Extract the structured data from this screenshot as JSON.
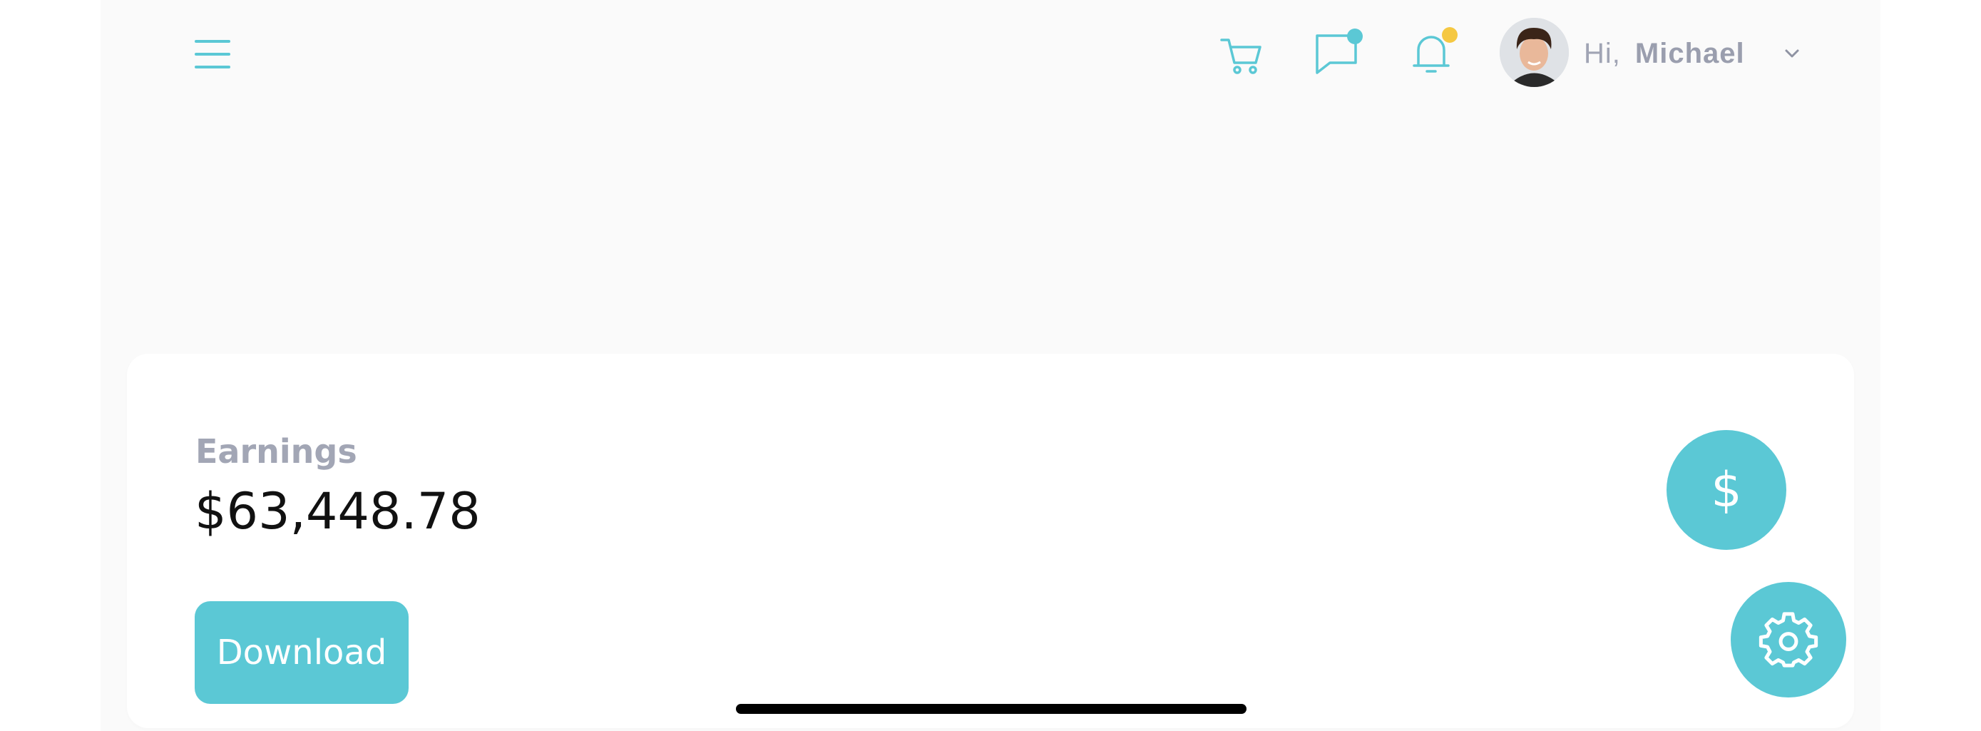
{
  "header": {
    "greeting_prefix": "Hi,",
    "user_name": "Michael",
    "icons": {
      "menu": "hamburger-menu-icon",
      "cart": "shopping-cart-icon",
      "messages": "chat-bubble-icon",
      "notifications": "bell-icon",
      "dropdown": "chevron-down-icon"
    },
    "badge_colors": {
      "messages": "#5bc8d5",
      "notifications": "#f5c842"
    }
  },
  "card": {
    "label": "Earnings",
    "value": "$63,448.78",
    "button_label": "Download",
    "icon_symbol": "$"
  },
  "fab": {
    "icon": "gear-icon"
  },
  "colors": {
    "accent": "#5bc8d5",
    "background": "#fafafa",
    "card": "#ffffff",
    "muted_text": "#a2a6b5",
    "notification_dot": "#f5c842"
  }
}
